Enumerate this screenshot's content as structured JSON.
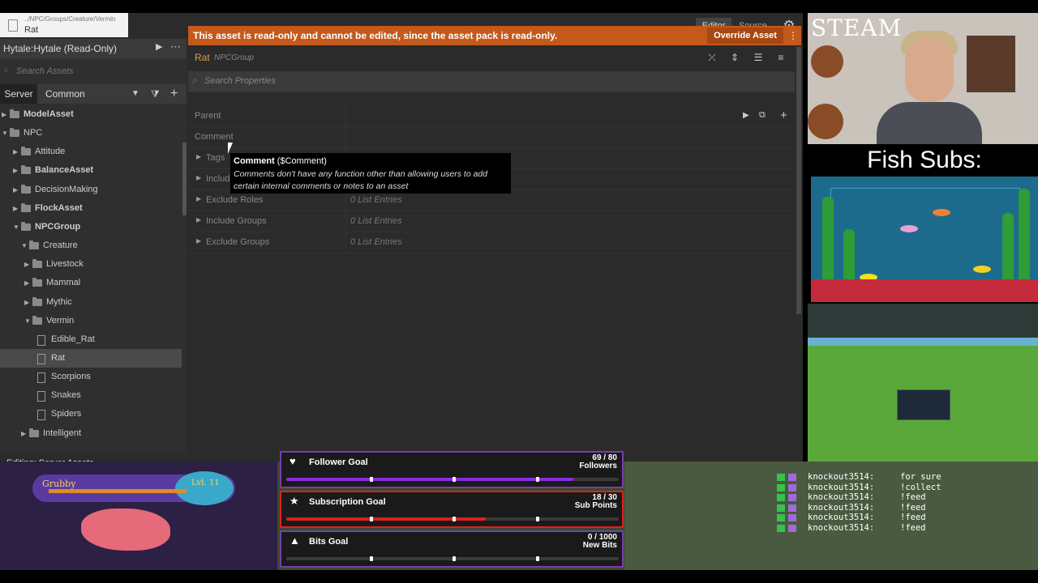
{
  "window": {
    "file_path": "../NPC/Groups/Creature/Vermin",
    "file_name": "Rat",
    "editor_label": "Editor",
    "source_label": "Source"
  },
  "left_panel": {
    "pack_label": "Hytale:Hytale (Read-Only)",
    "search_placeholder": "Search Assets",
    "server_tab": "Server",
    "common_select": "Common",
    "tree": [
      {
        "label": "ModelAsset",
        "bold": true,
        "level": 0,
        "expanded": false
      },
      {
        "label": "NPC",
        "bold": false,
        "level": 0,
        "expanded": true
      },
      {
        "label": "Attitude",
        "bold": false,
        "level": 1,
        "expanded": false
      },
      {
        "label": "BalanceAsset",
        "bold": true,
        "level": 1,
        "expanded": false
      },
      {
        "label": "DecisionMaking",
        "bold": false,
        "level": 1,
        "expanded": false
      },
      {
        "label": "FlockAsset",
        "bold": true,
        "level": 1,
        "expanded": false
      },
      {
        "label": "NPCGroup",
        "bold": true,
        "level": 1,
        "expanded": true
      },
      {
        "label": "Creature",
        "bold": false,
        "level": 2,
        "expanded": true
      },
      {
        "label": "Livestock",
        "bold": false,
        "level": 3,
        "expanded": false
      },
      {
        "label": "Mammal",
        "bold": false,
        "level": 3,
        "expanded": false
      },
      {
        "label": "Mythic",
        "bold": false,
        "level": 3,
        "expanded": false
      },
      {
        "label": "Vermin",
        "bold": false,
        "level": 3,
        "expanded": true
      },
      {
        "label": "Edible_Rat",
        "bold": false,
        "level": 4,
        "file": true
      },
      {
        "label": "Rat",
        "bold": false,
        "level": 4,
        "file": true,
        "selected": true
      },
      {
        "label": "Scorpions",
        "bold": false,
        "level": 4,
        "file": true
      },
      {
        "label": "Snakes",
        "bold": false,
        "level": 4,
        "file": true
      },
      {
        "label": "Spiders",
        "bold": false,
        "level": 4,
        "file": true
      },
      {
        "label": "Intelligent",
        "bold": false,
        "level": 2,
        "expanded": false
      }
    ],
    "status": "Editing: Server Assets"
  },
  "main": {
    "banner": "This asset is read-only and cannot be edited, since the asset pack is read-only.",
    "override_label": "Override Asset",
    "asset_name": "Rat",
    "asset_type": "NPCGroup",
    "search_placeholder": "Search Properties",
    "properties": [
      {
        "label": "Parent",
        "value": "",
        "toggle": false
      },
      {
        "label": "Comment",
        "value": "",
        "toggle": false
      },
      {
        "label": "Tags",
        "value": "",
        "toggle": true
      },
      {
        "label": "Include",
        "value": "",
        "toggle": true
      },
      {
        "label": "Exclude Roles",
        "value": "0 List Entries",
        "toggle": true
      },
      {
        "label": "Include Groups",
        "value": "0 List Entries",
        "toggle": true
      },
      {
        "label": "Exclude Groups",
        "value": "0 List Entries",
        "toggle": true
      }
    ],
    "tooltip": {
      "title": "Comment",
      "key": "($Comment)",
      "text": "Comments don't have any function other than allowing users to add certain internal comments or notes to an asset"
    }
  },
  "overlay": {
    "steam_label": "STEAM",
    "fish_label": "Fish Subs:",
    "goals": [
      {
        "name": "Follower Goal",
        "current": "69 / 80",
        "unit": "Followers",
        "progress": 0.8625,
        "color": "#8a2be2",
        "icon": "heart-icon"
      },
      {
        "name": "Subscription Goal",
        "current": "18 / 30",
        "unit": "Sub Points",
        "progress": 0.6,
        "color": "#e02020",
        "icon": "star-icon"
      },
      {
        "name": "Bits Goal",
        "current": "0 / 1000",
        "unit": "New Bits",
        "progress": 0.0,
        "color": "#8a2be2",
        "icon": "diamond-icon"
      }
    ],
    "pet": {
      "name": "Grubby",
      "level": "Lvl. 11"
    },
    "chat": [
      {
        "user": "knockout3514:",
        "msg": "for sure"
      },
      {
        "user": "knockout3514:",
        "msg": "!collect"
      },
      {
        "user": "knockout3514:",
        "msg": "!feed"
      },
      {
        "user": "knockout3514:",
        "msg": "!feed"
      },
      {
        "user": "knockout3514:",
        "msg": "!feed"
      },
      {
        "user": "knockout3514:",
        "msg": "!feed"
      }
    ]
  }
}
